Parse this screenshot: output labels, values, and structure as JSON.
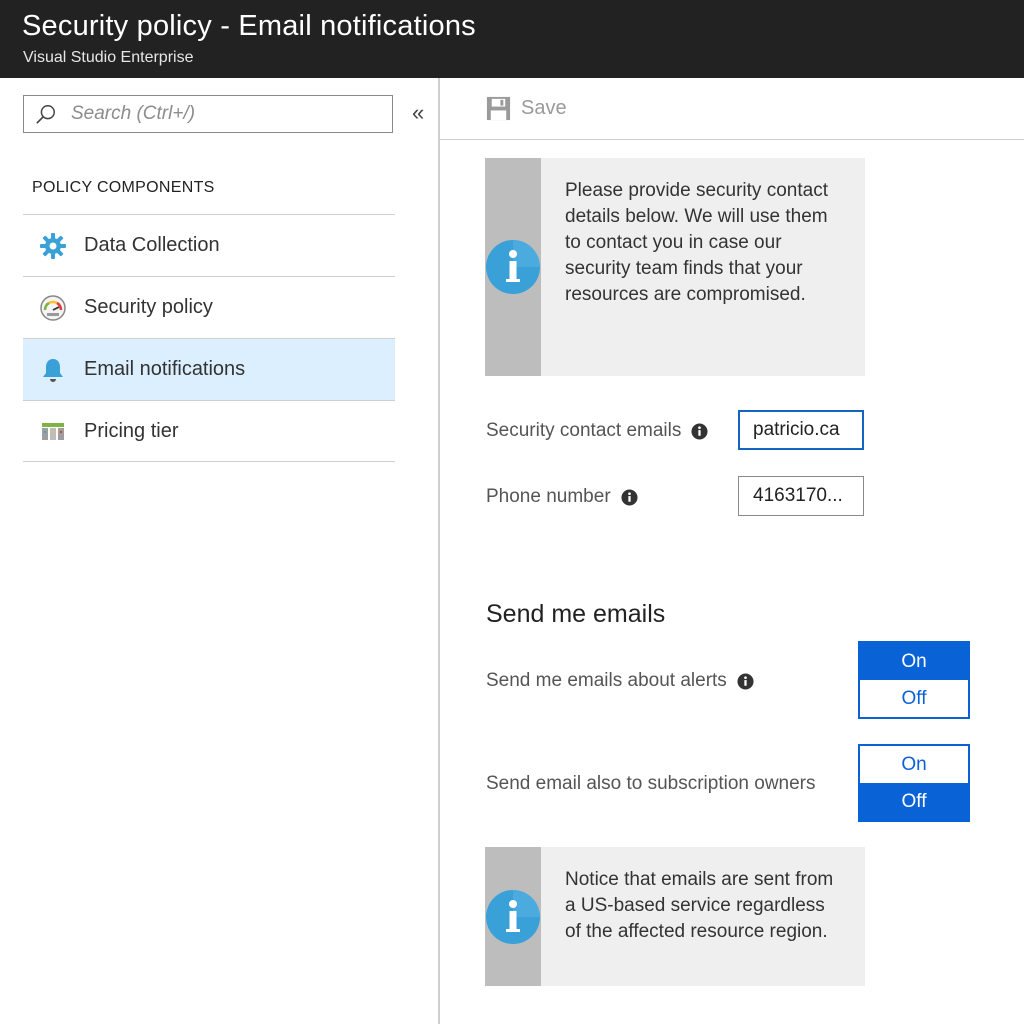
{
  "window": {
    "title": "Security policy - Email notifications",
    "subtitle": "Visual Studio Enterprise"
  },
  "sidebar": {
    "search": {
      "placeholder": "Search (Ctrl+/)",
      "value": ""
    },
    "collapse_label": "«",
    "section_header": "POLICY COMPONENTS",
    "items": [
      {
        "label": "Data Collection",
        "icon": "gear-icon",
        "active": false
      },
      {
        "label": "Security policy",
        "icon": "gauge-icon",
        "active": false
      },
      {
        "label": "Email notifications",
        "icon": "bell-icon",
        "active": true
      },
      {
        "label": "Pricing tier",
        "icon": "pricing-icon",
        "active": false
      }
    ]
  },
  "toolbar": {
    "save_label": "Save"
  },
  "main": {
    "info_top": "Please provide security contact details below. We will use them to contact you in case our security team finds that your resources are compromised.",
    "fields": {
      "emails_label": "Security contact emails",
      "emails_value": "patricio.ca",
      "phone_label": "Phone number",
      "phone_value": "4163170..."
    },
    "send_section_title": "Send me emails",
    "alerts_label": "Send me emails about alerts",
    "alerts_toggle": {
      "on": "On",
      "off": "Off",
      "selected": "On"
    },
    "owners_label": "Send email also to subscription owners",
    "owners_toggle": {
      "on": "On",
      "off": "Off",
      "selected": "Off"
    },
    "info_bottom": "Notice that emails are sent from a US-based service regardless of the affected resource region."
  },
  "colors": {
    "titlebar": "#222222",
    "accent": "#0a63d6",
    "active_nav": "#dcefff",
    "info_icon": "#3aa0d8"
  }
}
